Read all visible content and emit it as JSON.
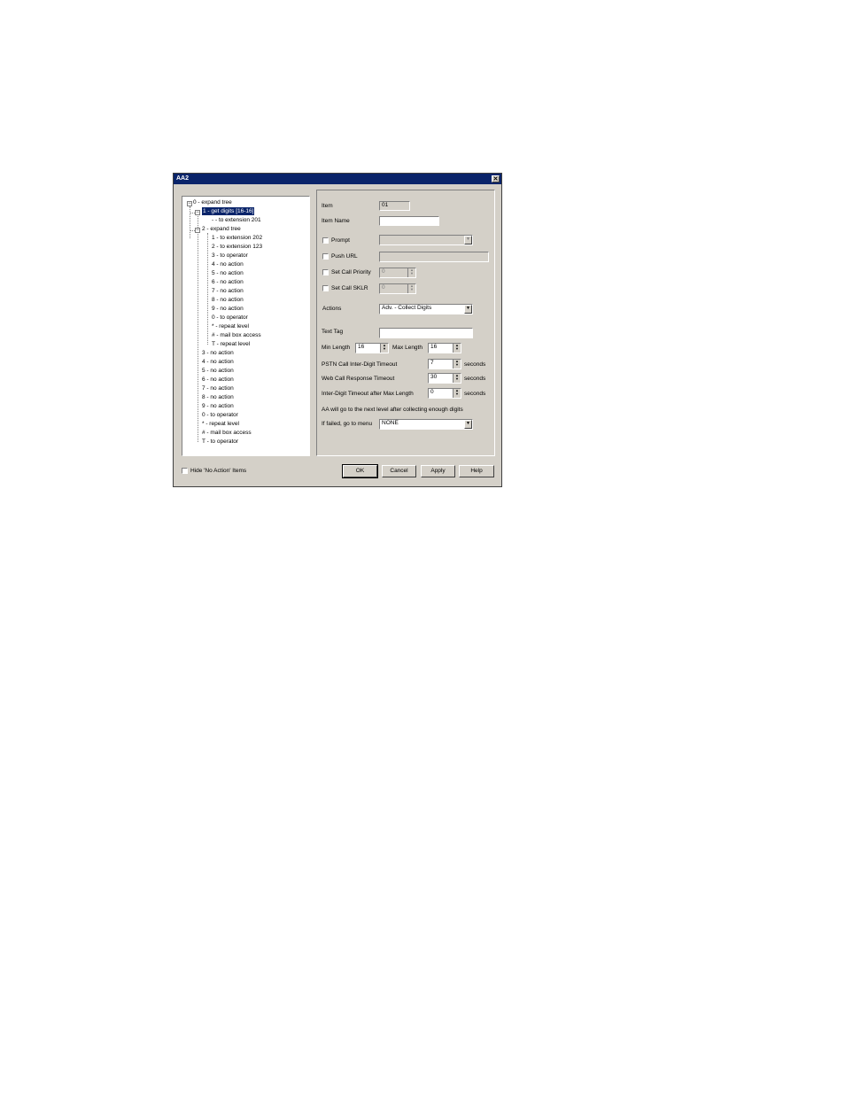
{
  "window": {
    "title": "AA2",
    "close_glyph": "✕"
  },
  "tree": {
    "items": [
      {
        "label": "0 - expand tree"
      },
      {
        "label": "1 - get digits [16-16]"
      },
      {
        "label": "- - to extension 201"
      },
      {
        "label": "2 - expand tree"
      },
      {
        "label": "1 - to extension 202"
      },
      {
        "label": "2 - to extension 123"
      },
      {
        "label": "3 - to operator"
      },
      {
        "label": "4 - no action"
      },
      {
        "label": "5 - no action"
      },
      {
        "label": "6 - no action"
      },
      {
        "label": "7 - no action"
      },
      {
        "label": "8 - no action"
      },
      {
        "label": "9 - no action"
      },
      {
        "label": "0 - to operator"
      },
      {
        "label": "* - repeat level"
      },
      {
        "label": "# - mail box access"
      },
      {
        "label": "T - repeat level"
      },
      {
        "label": "3 - no action"
      },
      {
        "label": "4 - no action"
      },
      {
        "label": "5 - no action"
      },
      {
        "label": "6 - no action"
      },
      {
        "label": "7 - no action"
      },
      {
        "label": "8 - no action"
      },
      {
        "label": "9 - no action"
      },
      {
        "label": "0 - to operator"
      },
      {
        "label": "* - repeat level"
      },
      {
        "label": "# - mail box access"
      },
      {
        "label": "T - to operator"
      }
    ],
    "expand_glyph": "−"
  },
  "props": {
    "item_label": "Item",
    "item_value": "01",
    "item_name_label": "Item Name",
    "item_name_value": "",
    "prompt_label": "Prompt",
    "push_url_label": "Push URL",
    "set_call_priority_label": "Set Call Priority",
    "set_call_priority_value": "0",
    "set_call_sklr_label": "Set Call SKLR",
    "set_call_sklr_value": "0",
    "actions_label": "Actions",
    "actions_value": "Adv. - Collect Digits",
    "text_tag_label": "Text Tag",
    "text_tag_value": "",
    "min_length_label": "Min Length",
    "min_length_value": "16",
    "max_length_label": "Max Length",
    "max_length_value": "16",
    "pstn_timeout_label": "PSTN Call Inter-Digit Timeout",
    "pstn_timeout_value": "7",
    "web_timeout_label": "Web Call Response Timeout",
    "web_timeout_value": "30",
    "interdigit_after_max_label": "Inter-Digit Timeout after Max Length",
    "interdigit_after_max_value": "0",
    "seconds_unit": "seconds",
    "info_text": "AA will go to the next level after collecting enough digits",
    "if_failed_label": "If failed, go to menu",
    "if_failed_value": "NONE",
    "dropdown_glyph": "▼",
    "spin_up_glyph": "▲",
    "spin_down_glyph": "▼"
  },
  "footer": {
    "hide_no_action_label": "Hide 'No Action' Items",
    "ok_label": "OK",
    "cancel_label": "Cancel",
    "apply_label": "Apply",
    "help_label": "Help"
  }
}
